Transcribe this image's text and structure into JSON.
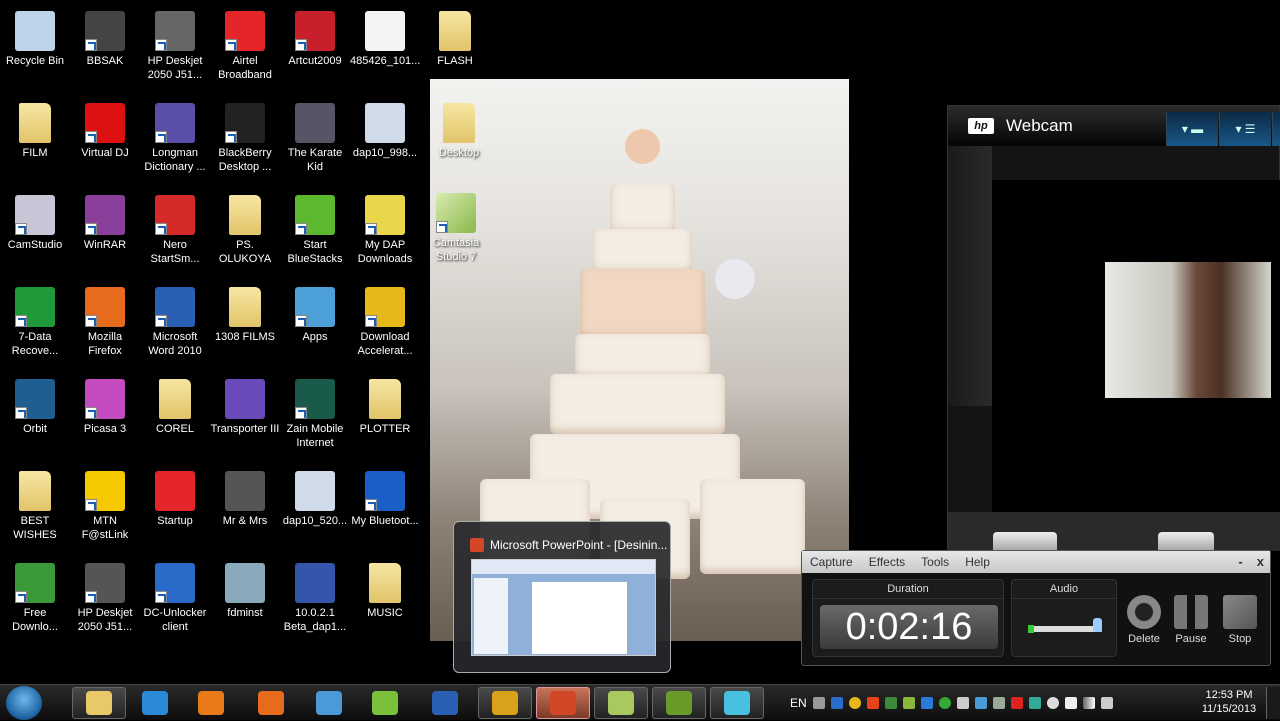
{
  "desktop": {
    "icons": [
      {
        "label": "Recycle Bin",
        "icon": "recycle-bin-icon",
        "color": "#bcd3e8",
        "shortcut": false
      },
      {
        "label": "BBSAK",
        "icon": "tools-icon",
        "color": "#444",
        "shortcut": true
      },
      {
        "label": "HP Deskjet 2050 J51...",
        "icon": "printer-icon",
        "color": "#666",
        "shortcut": true
      },
      {
        "label": "Airtel Broadband",
        "icon": "airtel-icon",
        "color": "#e4262b",
        "shortcut": true
      },
      {
        "label": "Artcut2009",
        "icon": "artcut-icon",
        "color": "#c8202a",
        "shortcut": true
      },
      {
        "label": "485426_101...",
        "icon": "image-file-icon",
        "color": "#f4f4f4",
        "shortcut": false
      },
      {
        "label": "FLASH",
        "icon": "folder-icon",
        "color": "folder",
        "shortcut": false
      },
      {
        "label": "FILM",
        "icon": "folder-icon",
        "color": "folder",
        "shortcut": false
      },
      {
        "label": "Virtual DJ",
        "icon": "virtual-dj-icon",
        "color": "#d11",
        "shortcut": true
      },
      {
        "label": "Longman Dictionary ...",
        "icon": "longman-icon",
        "color": "#5a4fa8",
        "shortcut": true
      },
      {
        "label": "BlackBerry Desktop ...",
        "icon": "blackberry-icon",
        "color": "#222",
        "shortcut": true
      },
      {
        "label": "The Karate Kid",
        "icon": "video-file-icon",
        "color": "#556",
        "shortcut": false
      },
      {
        "label": "dap10_998...",
        "icon": "installer-icon",
        "color": "#cfdbe8",
        "shortcut": false
      },
      {
        "label": "CamStudio",
        "icon": "camstudio-icon",
        "color": "#c6c6d6",
        "shortcut": true
      },
      {
        "label": "WinRAR",
        "icon": "winrar-icon",
        "color": "#8a3f9a",
        "shortcut": true
      },
      {
        "label": "Nero StartSm...",
        "icon": "nero-icon",
        "color": "#d42a2a",
        "shortcut": true
      },
      {
        "label": "PS. OLUKOYA",
        "icon": "folder-icon",
        "color": "folder",
        "shortcut": false
      },
      {
        "label": "Start BlueStacks",
        "icon": "bluestacks-icon",
        "color": "#5cb82e",
        "shortcut": true
      },
      {
        "label": "My DAP Downloads",
        "icon": "download-folder-icon",
        "color": "#e9d64a",
        "shortcut": true
      },
      {
        "label": "7-Data Recove...",
        "icon": "data-recovery-icon",
        "color": "#1e9a3a",
        "shortcut": true
      },
      {
        "label": "Mozilla Firefox",
        "icon": "firefox-icon",
        "color": "#e76b1c",
        "shortcut": true
      },
      {
        "label": "Microsoft Word 2010",
        "icon": "word-icon",
        "color": "#2b5fb4",
        "shortcut": true
      },
      {
        "label": "1308 FILMS",
        "icon": "folder-icon",
        "color": "folder",
        "shortcut": false
      },
      {
        "label": "Apps",
        "icon": "apps-icon",
        "color": "#4ea0d8",
        "shortcut": true
      },
      {
        "label": "Download Accelerat...",
        "icon": "dap-icon",
        "color": "#e8b81a",
        "shortcut": true
      },
      {
        "label": "Orbit",
        "icon": "orbit-icon",
        "color": "#1f5e91",
        "shortcut": true
      },
      {
        "label": "Picasa 3",
        "icon": "picasa-icon",
        "color": "#c44ac0",
        "shortcut": true
      },
      {
        "label": "COREL",
        "icon": "folder-icon",
        "color": "folder",
        "shortcut": false
      },
      {
        "label": "Transporter III",
        "icon": "video-file-icon",
        "color": "#6a4ab8",
        "shortcut": false
      },
      {
        "label": "Zain Mobile Internet",
        "icon": "zain-icon",
        "color": "#1a5a4a",
        "shortcut": true
      },
      {
        "label": "PLOTTER",
        "icon": "folder-icon",
        "color": "folder",
        "shortcut": false
      },
      {
        "label": "BEST WISHES",
        "icon": "folder-icon",
        "color": "folder",
        "shortcut": false
      },
      {
        "label": "MTN F@stLink",
        "icon": "mtn-icon",
        "color": "#f5c800",
        "shortcut": true
      },
      {
        "label": "Startup",
        "icon": "airtel-icon",
        "color": "#e4262b",
        "shortcut": false
      },
      {
        "label": "Mr & Mrs",
        "icon": "video-file-icon",
        "color": "#555",
        "shortcut": false
      },
      {
        "label": "dap10_520...",
        "icon": "installer-icon",
        "color": "#cfdbe8",
        "shortcut": false
      },
      {
        "label": "My Bluetoot...",
        "icon": "bluetooth-icon",
        "color": "#1a5fc8",
        "shortcut": true
      },
      {
        "label": "Free Downlo...",
        "icon": "fdm-icon",
        "color": "#3a9a3a",
        "shortcut": true
      },
      {
        "label": "HP Deskjet 2050 J51...",
        "icon": "scanner-icon",
        "color": "#555",
        "shortcut": true
      },
      {
        "label": "DC-Unlocker client",
        "icon": "dc-unlocker-icon",
        "color": "#2a6ac8",
        "shortcut": true
      },
      {
        "label": "fdminst",
        "icon": "setup-icon",
        "color": "#8ab",
        "shortcut": false
      },
      {
        "label": "10.0.2.1 Beta_dap1...",
        "icon": "setup-icon",
        "color": "#35a",
        "shortcut": false
      },
      {
        "label": "MUSIC",
        "icon": "folder-icon",
        "color": "folder",
        "shortcut": false
      }
    ],
    "photo_icons": [
      {
        "label": "Desktop",
        "icon": "folder-icon"
      },
      {
        "label": "Camtasia Studio 7",
        "icon": "camtasia-icon"
      }
    ]
  },
  "webcam": {
    "title": "Webcam",
    "logo": "hp"
  },
  "thumbnail": {
    "title": "Microsoft PowerPoint - [Desinin..."
  },
  "recorder": {
    "menu": [
      "Capture",
      "Effects",
      "Tools",
      "Help"
    ],
    "minimize": "-",
    "close": "x",
    "duration_label": "Duration",
    "duration": "0:02:16",
    "audio_label": "Audio",
    "audio_level": 0.95,
    "buttons": [
      "Delete",
      "Pause",
      "Stop"
    ]
  },
  "taskbar": {
    "apps": [
      {
        "name": "windows-explorer",
        "color": "#e9c86a",
        "open": true
      },
      {
        "name": "internet-explorer",
        "color": "#2a8ad8",
        "open": false
      },
      {
        "name": "media-player",
        "color": "#e87a1a",
        "open": false
      },
      {
        "name": "firefox",
        "color": "#e76b1c",
        "open": false
      },
      {
        "name": "photo-viewer",
        "color": "#4a9ad8",
        "open": false
      },
      {
        "name": "coreldraw",
        "color": "#7ac03a",
        "open": false
      },
      {
        "name": "word",
        "color": "#2b5fb4",
        "open": false
      },
      {
        "name": "chrome",
        "color": "#d9a21a",
        "open": true
      },
      {
        "name": "powerpoint",
        "color": "#d24726",
        "open": true,
        "active": true
      },
      {
        "name": "camtasia",
        "color": "#a8c860",
        "open": true
      },
      {
        "name": "camtasia-recorder",
        "color": "#6a9a2a",
        "open": true
      },
      {
        "name": "webcam",
        "color": "#4ac0e0",
        "open": true
      }
    ],
    "language": "EN",
    "time": "12:53 PM",
    "date": "11/15/2013"
  }
}
